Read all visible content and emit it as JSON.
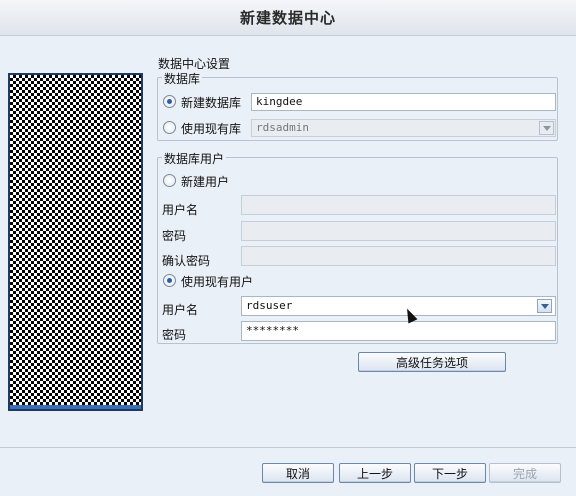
{
  "window": {
    "title": "新建数据中心"
  },
  "section_title": "数据中心设置",
  "database": {
    "legend": "数据库",
    "new_db_label": "新建数据库",
    "new_db_value": "kingdee",
    "existing_db_label": "使用现有库",
    "existing_db_value": "rdsadmin"
  },
  "db_user": {
    "legend": "数据库用户",
    "new_user_label": "新建用户",
    "new_username_label": "用户名",
    "new_password_label": "密码",
    "confirm_password_label": "确认密码",
    "existing_user_label": "使用现有用户",
    "existing_username_label": "用户名",
    "existing_username_value": "rdsuser",
    "existing_password_label": "密码",
    "existing_password_value": "********"
  },
  "advanced_button": "高级任务选项",
  "footer": {
    "cancel": "取消",
    "back": "上一步",
    "next": "下一步",
    "finish": "完成"
  }
}
